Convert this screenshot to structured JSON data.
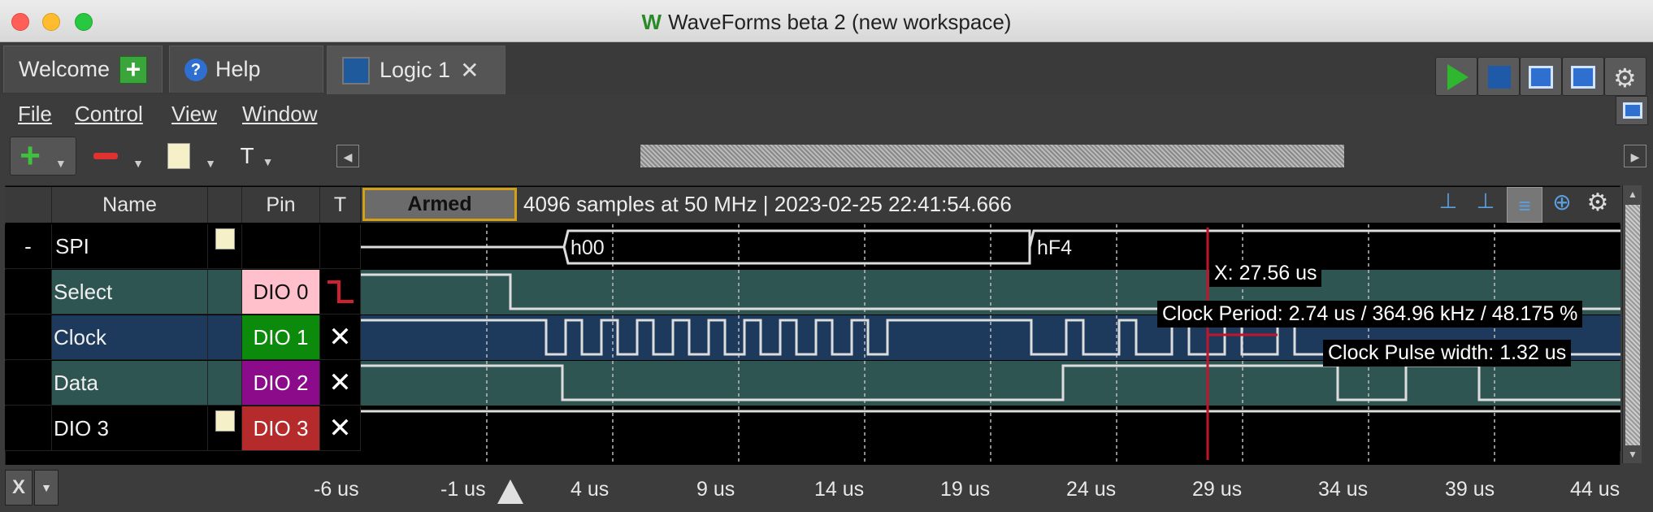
{
  "window": {
    "title": "WaveForms beta 2 (new workspace)"
  },
  "tabs": [
    {
      "label": "Welcome"
    },
    {
      "label": "Help"
    },
    {
      "label": "Logic 1"
    }
  ],
  "menu": {
    "file": "File",
    "control": "Control",
    "view": "View",
    "window": "Window"
  },
  "toolbar": {
    "text_tool": "T"
  },
  "grid": {
    "headers": {
      "name": "Name",
      "pin": "Pin",
      "t": "T"
    },
    "status": "Armed",
    "info": "4096 samples at 50 MHz | 2023-02-25 22:41:54.666",
    "rows": [
      {
        "expander": "-",
        "name": "SPI",
        "pin": "",
        "bus_values": [
          "h00",
          "hF4"
        ]
      },
      {
        "name": "Select",
        "pin": "DIO 0"
      },
      {
        "name": "Clock",
        "pin": "DIO 1"
      },
      {
        "name": "Data",
        "pin": "DIO 2"
      },
      {
        "name": "DIO 3",
        "pin": "DIO 3"
      }
    ]
  },
  "measurements": {
    "cursor_x": "X: 27.56 us",
    "clock_period": "Clock Period: 2.74 us / 364.96 kHz / 48.175 %",
    "pulse_width": "Clock Pulse width: 1.32 us"
  },
  "time_axis": {
    "ticks": [
      "-6 us",
      "-1 us",
      "4 us",
      "9 us",
      "14 us",
      "19 us",
      "24 us",
      "29 us",
      "34 us",
      "39 us",
      "44 us"
    ],
    "clear_button": "X"
  },
  "colors": {
    "pin_dio0": "#ffc0cb",
    "pin_dio1": "#0b8a0b",
    "pin_dio2": "#8b0b8b",
    "pin_dio3": "#b52a2a",
    "row_teal": "#2f5552",
    "row_blue": "#1d3a5c",
    "cursor": "#c0152a"
  }
}
